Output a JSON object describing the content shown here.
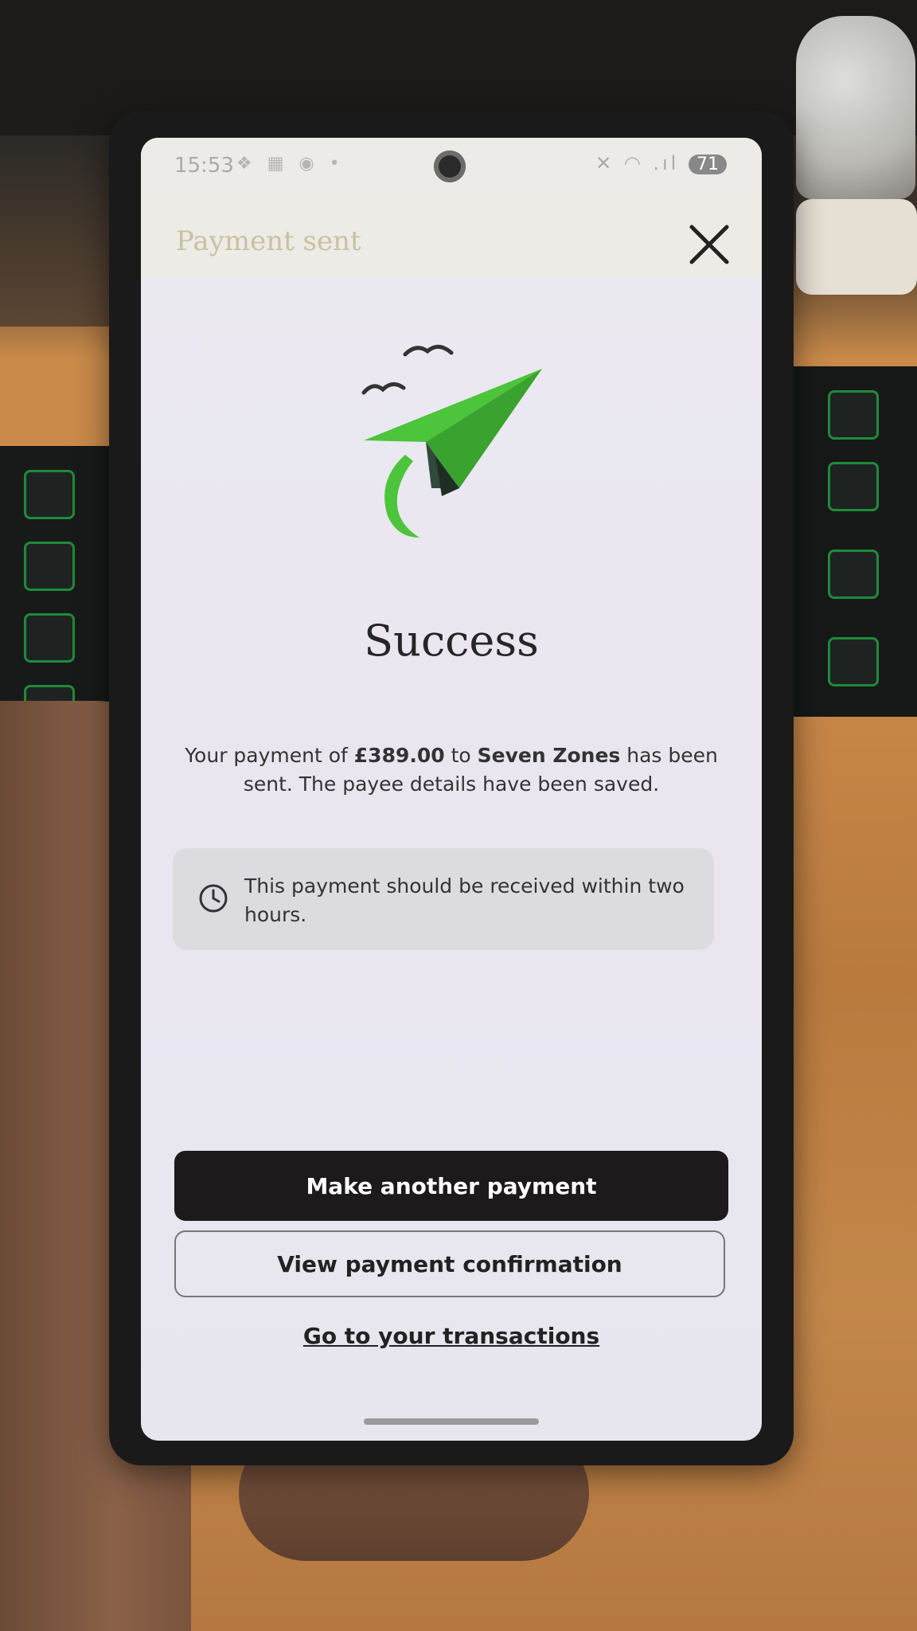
{
  "status_bar": {
    "time": "15:53",
    "left_icons": "❖ ▦ ◉ •",
    "right_icons": "✕ ◠ .ıl",
    "battery": "71"
  },
  "header": {
    "title": "Payment sent",
    "close_icon": "close-icon"
  },
  "illustration": {
    "icon": "paper-plane-icon",
    "colors": {
      "plane_green": "#4cc43c",
      "plane_dark": "#2f4a3a",
      "birds": "#333333"
    }
  },
  "main": {
    "title": "Success",
    "message_prefix": "Your payment of ",
    "amount": "£389.00",
    "message_mid": " to ",
    "payee": "Seven Zones",
    "message_suffix": " has been sent. The payee details have been saved.",
    "info_text": "This payment should be received within two hours."
  },
  "actions": {
    "primary_label": "Make another payment",
    "secondary_label": "View payment confirmation",
    "link_label": "Go to your transactions"
  },
  "colors": {
    "primary_button_bg": "#1d1a1b",
    "info_box_bg": "#dcdbe0",
    "screen_bg": "#eae7f1"
  }
}
